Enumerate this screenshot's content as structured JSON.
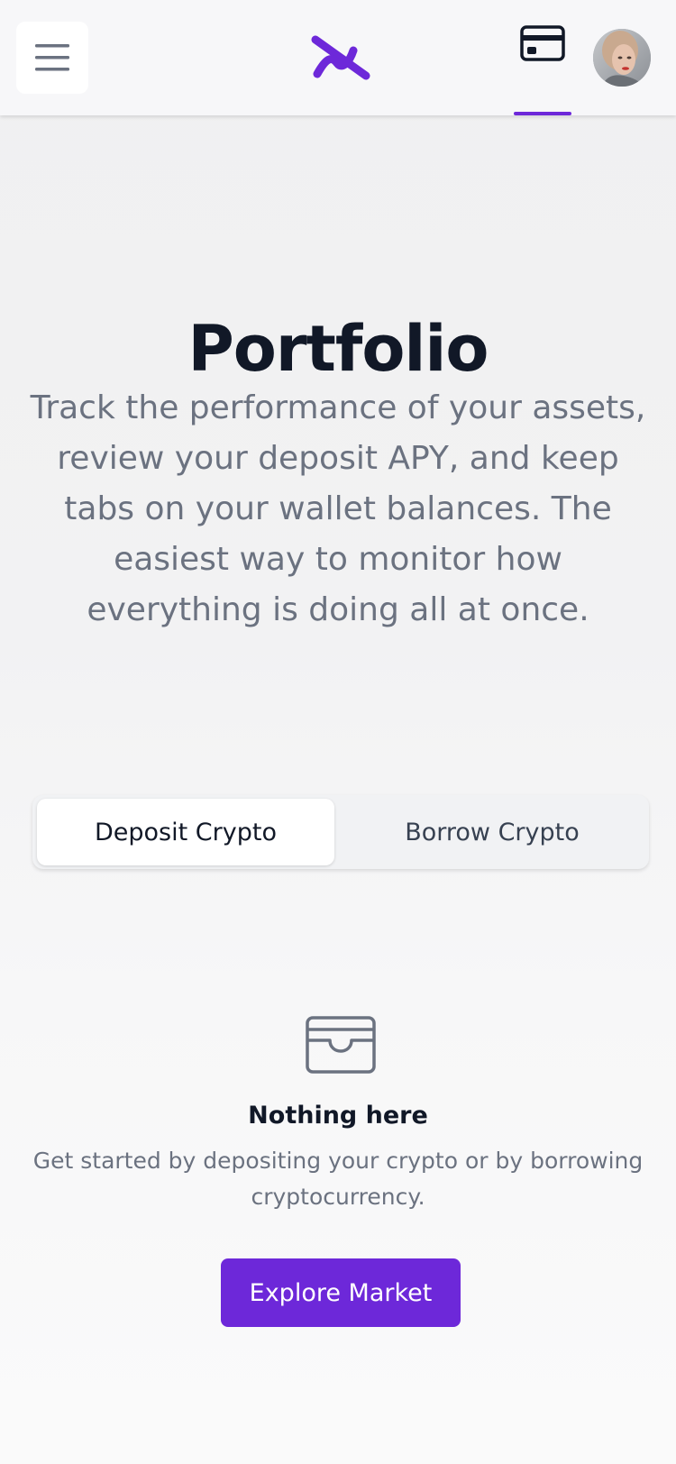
{
  "header": {
    "menu_icon": "hamburger-menu-icon",
    "logo_icon": "brand-logo-icon",
    "card_icon": "credit-card-icon",
    "avatar": "user-avatar",
    "accent": "#6d28d9"
  },
  "main": {
    "title": "Portfolio",
    "description": "Track the performance of your assets, review your deposit APY, and keep tabs on your wallet balances. The easiest way to monitor how everything is doing all at once."
  },
  "tabs": [
    {
      "label": "Deposit Crypto",
      "active": true
    },
    {
      "label": "Borrow Crypto",
      "active": false
    }
  ],
  "empty_state": {
    "icon": "wallet-icon",
    "title": "Nothing here",
    "description": "Get started by depositing your crypto or by borrowing cryptocurrency.",
    "button_label": "Explore Market"
  },
  "colors": {
    "accent": "#6d28d9",
    "text_primary": "#111827",
    "text_secondary": "#6b7280"
  }
}
